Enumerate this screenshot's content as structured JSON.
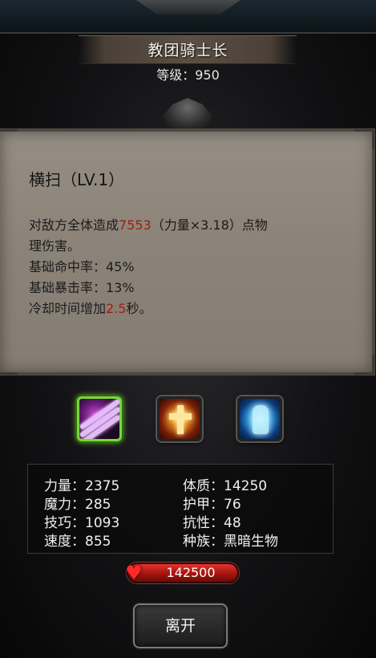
{
  "unit": {
    "name": "教团骑士长",
    "level": "等级：950"
  },
  "skill": {
    "title": "横扫（LV.1）",
    "desc_line1_pre": "对敌方全体造成",
    "desc_damage": "7553",
    "desc_line1_post": "（力量×3.18）点物",
    "desc_line2": "理伤害。",
    "hit_rate": "基础命中率：45%",
    "crit_rate": "基础暴击率：13%",
    "cooldown_pre": "冷却时间增加",
    "cooldown_value": "2.5",
    "cooldown_post": "秒。"
  },
  "skill_icons": [
    {
      "icon": "sweep-slash-icon",
      "selected": true
    },
    {
      "icon": "golden-holy-cross-icon",
      "selected": false
    },
    {
      "icon": "ice-guardian-icon",
      "selected": false
    }
  ],
  "stats": {
    "strength": "力量：2375",
    "magic": "魔力：285",
    "skill": "技巧：1093",
    "speed": "速度：855",
    "constitution": "体质：14250",
    "armor": "护甲：76",
    "resistance": "抗性：48",
    "race": "种族：黑暗生物"
  },
  "hp": {
    "value": "142500",
    "icon": "heart-icon"
  },
  "buttons": {
    "leave": "离开"
  },
  "colors": {
    "damage_highlight": "#9c1f14",
    "selected_border": "#7dd63a",
    "panel": "#8f877c"
  }
}
